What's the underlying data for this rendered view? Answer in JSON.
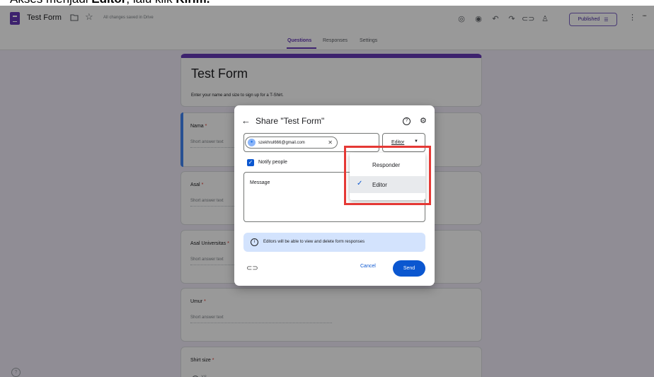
{
  "caption": {
    "prefix": "Akses menjadi ",
    "bold1": "Editor",
    "middle": ", lalu klik ",
    "bold2": "Kirim."
  },
  "topbar": {
    "title": "Test Form",
    "saved_status": "All changes saved in Drive",
    "published_label": "Published"
  },
  "tabs": [
    "Questions",
    "Responses",
    "Settings"
  ],
  "form": {
    "title": "Test Form",
    "description": "Enter your name and size to sign up for a T-Shirt.",
    "questions": [
      {
        "title": "Nama",
        "hint": "Short answer text"
      },
      {
        "title": "Asal",
        "hint": "Short answer text"
      },
      {
        "title": "Asal Universitas",
        "hint": "Short answer text"
      },
      {
        "title": "Umur",
        "hint": "Short answer text"
      },
      {
        "title": "Shirt size",
        "hint": "XS"
      }
    ],
    "required_mark": "*"
  },
  "dialog": {
    "title": "Share \"Test Form\"",
    "chip_email": "szekhrul666@gmail.com",
    "role_value": "Editor",
    "notify_label": "Notify people",
    "message_label": "Message",
    "info_text": "Editors will be able to view and delete form responses",
    "cancel_label": "Cancel",
    "send_label": "Send"
  },
  "role_menu": {
    "items": [
      "Responder",
      "Editor"
    ],
    "selected": "Editor"
  },
  "colors": {
    "accent": "#673ab7",
    "primary_blue": "#0b57d0",
    "highlight_red": "#e53935"
  }
}
